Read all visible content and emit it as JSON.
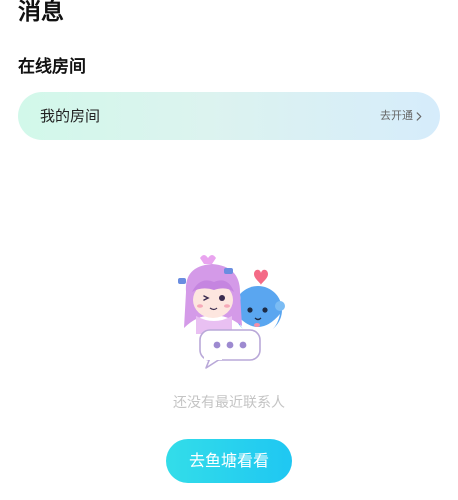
{
  "header": {
    "title": "消息"
  },
  "online_rooms": {
    "section_title": "在线房间",
    "my_room": {
      "label": "我的房间",
      "action_label": "去开通"
    }
  },
  "empty_state": {
    "illustration_icon": "chat-mascots-illustration",
    "message": "还没有最近联系人",
    "button_label": "去鱼塘看看"
  }
}
